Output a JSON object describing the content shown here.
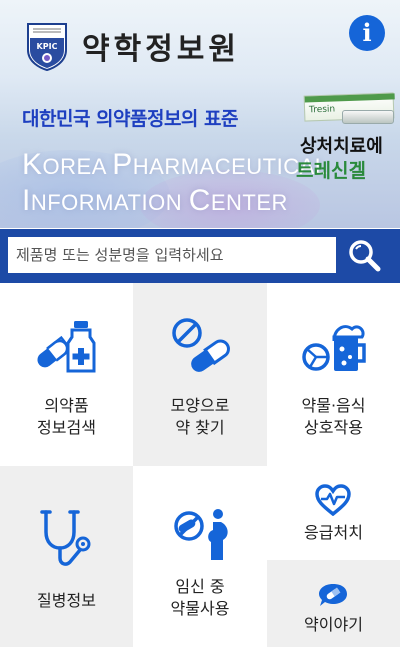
{
  "header": {
    "logo_text": "KPIC",
    "app_title": "약학정보원",
    "info_icon": "i",
    "slogan": "대한민국 의약품정보의 표준",
    "english_name": {
      "line1": [
        "K",
        "OREA ",
        "P",
        "HARMACEUTICAL"
      ],
      "line2": [
        "I",
        "NFORMATION ",
        "C",
        "ENTER"
      ]
    },
    "ad": {
      "line1": "상처치료에",
      "line2": "트레신겔"
    }
  },
  "search": {
    "placeholder": "제품명 또는 성분명을 입력하세요",
    "button_icon": "search-icon"
  },
  "menu": {
    "drug_search": {
      "line1": "의약품",
      "line2": "정보검색",
      "icon": "pills-bottle-icon"
    },
    "shape_search": {
      "line1": "모양으로",
      "line2": "약 찾기",
      "icon": "pill-shapes-icon"
    },
    "interaction": {
      "line1": "약물·음식",
      "line2": "상호작용",
      "icon": "food-drink-icon"
    },
    "disease": {
      "label": "질병정보",
      "icon": "stethoscope-icon"
    },
    "pregnancy": {
      "line1": "임신 중",
      "line2": "약물사용",
      "icon": "pregnancy-icon"
    },
    "first_aid": {
      "label": "응급처치",
      "icon": "heartbeat-icon"
    },
    "drug_stories": {
      "label": "약이야기",
      "icon": "pill-bubble-icon"
    }
  },
  "colors": {
    "brand_blue": "#1d4aa6",
    "icon_blue": "#1565d8",
    "tile_gray": "#efefef"
  }
}
